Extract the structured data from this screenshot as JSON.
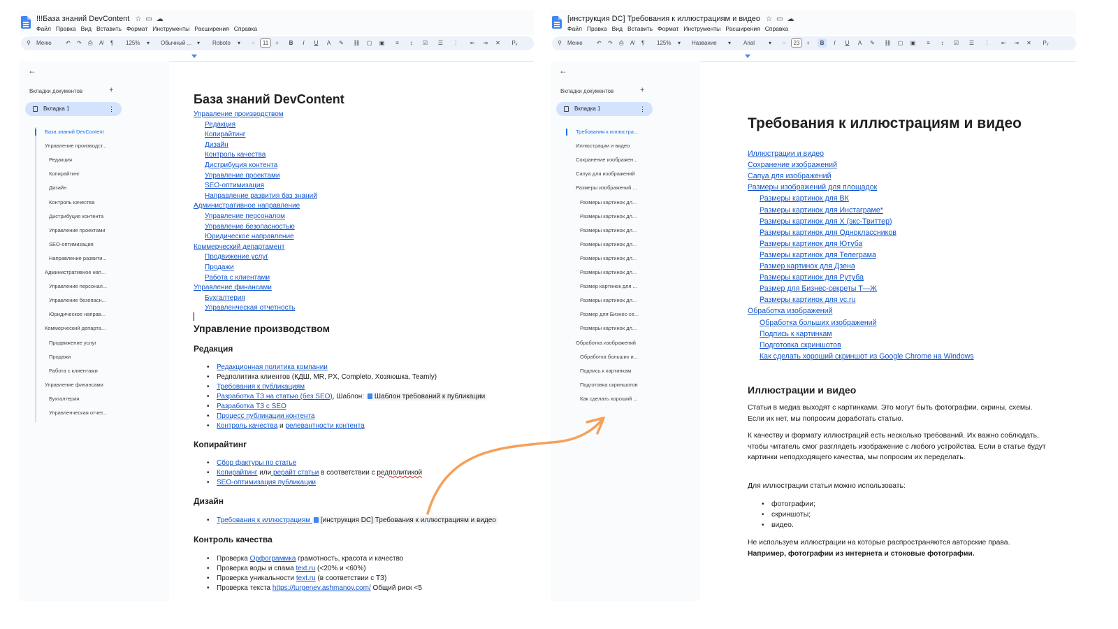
{
  "left": {
    "title": "!!!База знаний DevContent",
    "menu": [
      "Файл",
      "Правка",
      "Вид",
      "Вставить",
      "Формат",
      "Инструменты",
      "Расширения",
      "Справка"
    ],
    "toolbar": {
      "search": "Меню",
      "zoom": "125%",
      "style": "Обычный ...",
      "font": "Roboto",
      "size": "11"
    },
    "tabs_heading": "Вкладки документов",
    "tab": "Вкладка 1",
    "outline": [
      {
        "text": "База знаний DevContent",
        "level": 0,
        "active": true
      },
      {
        "text": "Управление производст...",
        "level": 1
      },
      {
        "text": "Редакция",
        "level": 2
      },
      {
        "text": "Копирайтинг",
        "level": 2
      },
      {
        "text": "Дизайн",
        "level": 2
      },
      {
        "text": "Контроль качества",
        "level": 2
      },
      {
        "text": "Дистрибуция контента",
        "level": 2
      },
      {
        "text": "Управление проектами",
        "level": 2
      },
      {
        "text": "SEO-оптимизация",
        "level": 2
      },
      {
        "text": "Направление развити...",
        "level": 2
      },
      {
        "text": "Административное нап...",
        "level": 1
      },
      {
        "text": "Управление персонал...",
        "level": 2
      },
      {
        "text": "Управление безопасн...",
        "level": 2
      },
      {
        "text": "Юридическое направ...",
        "level": 2
      },
      {
        "text": "Коммерческий департа...",
        "level": 1
      },
      {
        "text": "Продвижение услуг",
        "level": 2
      },
      {
        "text": "Продажи",
        "level": 2
      },
      {
        "text": "Работа с клиентами",
        "level": 2
      },
      {
        "text": "Управление финансами",
        "level": 1
      },
      {
        "text": "Бухгалтерия",
        "level": 2
      },
      {
        "text": "Управленческая отчет...",
        "level": 2
      }
    ],
    "doc": {
      "title": "База знаний DevContent",
      "toc": [
        {
          "text": "Управление производством",
          "level": 0
        },
        {
          "text": "Редакция",
          "level": 1
        },
        {
          "text": "Копирайтинг",
          "level": 1
        },
        {
          "text": "Дизайн",
          "level": 1
        },
        {
          "text": "Контроль качества",
          "level": 1
        },
        {
          "text": "Дистрибуция контента",
          "level": 1
        },
        {
          "text": "Управление проектами",
          "level": 1
        },
        {
          "text": "SEO-оптимизация",
          "level": 1
        },
        {
          "text": "Направление развития баз знаний",
          "level": 1
        },
        {
          "text": "Административное направление",
          "level": 0
        },
        {
          "text": "Управление персоналом",
          "level": 1
        },
        {
          "text": "Управление безопасностью",
          "level": 1
        },
        {
          "text": "Юридическое направление",
          "level": 1
        },
        {
          "text": "Коммерческий департамент",
          "level": 0
        },
        {
          "text": "Продвижение услуг",
          "level": 1
        },
        {
          "text": "Продажи",
          "level": 1
        },
        {
          "text": "Работа с клиентами",
          "level": 1
        },
        {
          "text": "Управление финансами",
          "level": 0
        },
        {
          "text": "Бухгалтерия",
          "level": 1
        },
        {
          "text": "Управленческая отчетность",
          "level": 1
        }
      ],
      "h_prod": "Управление производством",
      "h_red": "Редакция",
      "red": {
        "b1": "Редакционная политика компании",
        "b2": "Редполитика клиентов (КДШ, MR, PX, Completo, Хозяюшка, Teamly)",
        "b3": "Требования к публикациям",
        "b4a": "Разработка ТЗ на статью (без SEO)",
        "b4b": ", Шаблон: ",
        "b4c": "Шаблон требований к публикации",
        "b5": "Разработка ТЗ с SEO",
        "b6": "Процесс публикации контента",
        "b7a": "Контроль качества",
        "b7b": " и ",
        "b7c": "релевантности контента"
      },
      "h_copy": "Копирайтинг",
      "copy": {
        "b1": "Сбор фактуры по статье",
        "b2a": "Копирайтинг",
        "b2b": " или",
        "b2c": " рерайт статьи",
        "b2d": " в соответствии с ",
        "b2e": "редполитикой",
        "b3": "SEO-оптимизация публикации"
      },
      "h_design": "Дизайн",
      "design": {
        "b1a": "Требования к иллюстрациям ",
        "b1b": "[инструкция DC] Требования к иллюстрациям и видео"
      },
      "h_qc": "Контроль качества",
      "qc": {
        "b1a": "Проверка ",
        "b1b": "Орфограммка",
        "b1c": " грамотность, красота и качество",
        "b2a": "Проверка воды и спама ",
        "b2b": "text.ru",
        "b2c": " (<20% и <60%)",
        "b3a": "Проверка уникальности ",
        "b3b": "text.ru",
        "b3c": " (в соответствии с ТЗ)",
        "b4a": "Проверка текста ",
        "b4b": "https://turgenev.ashmanov.com/",
        "b4c": " Общий риск <5"
      }
    }
  },
  "right": {
    "title": "[инструкция DC] Требования к иллюстрациям и видео",
    "menu": [
      "Файл",
      "Правка",
      "Вид",
      "Вставить",
      "Формат",
      "Инструменты",
      "Расширения",
      "Справка"
    ],
    "toolbar": {
      "search": "Меню",
      "zoom": "125%",
      "style": "Название",
      "font": "Arial",
      "size": "23"
    },
    "tabs_heading": "Вкладки документов",
    "tab": "Вкладка 1",
    "outline": [
      {
        "text": "Требования к иллюстра...",
        "level": 0,
        "active": true
      },
      {
        "text": "Иллюстрации и видео",
        "level": 1
      },
      {
        "text": "Сохранение изображен...",
        "level": 1
      },
      {
        "text": "Сапуа для изображений",
        "level": 1
      },
      {
        "text": "Размеры изображений ...",
        "level": 1
      },
      {
        "text": "Размеры картинок дл...",
        "level": 2
      },
      {
        "text": "Размеры картинок дл...",
        "level": 2
      },
      {
        "text": "Размеры картинок дл...",
        "level": 2
      },
      {
        "text": "Размеры картинок дл...",
        "level": 2
      },
      {
        "text": "Размеры картинок дл...",
        "level": 2
      },
      {
        "text": "Размеры картинок дл...",
        "level": 2
      },
      {
        "text": "Размер картинок для ...",
        "level": 2
      },
      {
        "text": "Размеры картинок дл...",
        "level": 2
      },
      {
        "text": "Размер для Бизнес-се...",
        "level": 2
      },
      {
        "text": "Размеры картинок дл...",
        "level": 2
      },
      {
        "text": "Обработка изображений",
        "level": 1
      },
      {
        "text": "Обработка больших и...",
        "level": 2
      },
      {
        "text": "Подпись к картинкам",
        "level": 2
      },
      {
        "text": "Подготовка скриншотов",
        "level": 2
      },
      {
        "text": "Как сделать хороший ...",
        "level": 2
      }
    ],
    "doc": {
      "title": "Требования к иллюстрациям и видео",
      "toc": [
        {
          "text": "Иллюстрации и видео",
          "level": 0
        },
        {
          "text": "Сохранение изображений",
          "level": 0
        },
        {
          "text": "Сапуа для изображений",
          "level": 0
        },
        {
          "text": "Размеры изображений для площадок",
          "level": 0
        },
        {
          "text": "Размеры картинок для ВК",
          "level": 1
        },
        {
          "text": "Размеры картинок для Инстаграме*",
          "level": 1
        },
        {
          "text": "Размеры картинок для X (экс-Твиттер)",
          "level": 1
        },
        {
          "text": "Размеры картинок для Одноклассников",
          "level": 1
        },
        {
          "text": "Размеры картинок для Ютуба",
          "level": 1
        },
        {
          "text": "Размеры картинок для Телеграма",
          "level": 1
        },
        {
          "text": "Размер картинок для Дзена",
          "level": 1
        },
        {
          "text": "Размеры картинок для Рутуба",
          "level": 1
        },
        {
          "text": "Размер для Бизнес-секреты Т—Ж",
          "level": 1
        },
        {
          "text": "Размеры картинок для vc.ru",
          "level": 1
        },
        {
          "text": "Обработка изображений",
          "level": 0
        },
        {
          "text": "Обработка больших изображений",
          "level": 1
        },
        {
          "text": "Подпись к картинкам",
          "level": 1
        },
        {
          "text": "Подготовка скриншотов",
          "level": 1
        },
        {
          "text": "Как сделать хороший скриншот из Google Chrome на Windows",
          "level": 1
        }
      ],
      "h_ill": "Иллюстрации и видео",
      "p1": "Статьи в медиа выходят с картинками. Это могут быть фотографии, скрины, схемы. Если их нет, мы попросим доработать статью.",
      "p2": "К качеству и формату иллюстраций есть несколько требований. Их важно соблюдать, чтобы читатель смог разглядеть изображение с любого устройства. Если в статье будут картинки неподходящего качества, мы попросим их переделать.",
      "p3": "Для иллюстрации статьи можно использовать:",
      "list": [
        "фотографии;",
        "скриншоты;",
        "видео."
      ],
      "p4": "Не используем иллюстрации на которые распространяются авторские права.",
      "p5": "Например, фотографии из интернета и стоковые фотографии."
    }
  },
  "colors": {
    "link": "#1155cc",
    "active": "#1a73e8",
    "arrow": "#f5a05a",
    "pill": "#d3e3fd",
    "toolbar": "#edf2fa"
  }
}
